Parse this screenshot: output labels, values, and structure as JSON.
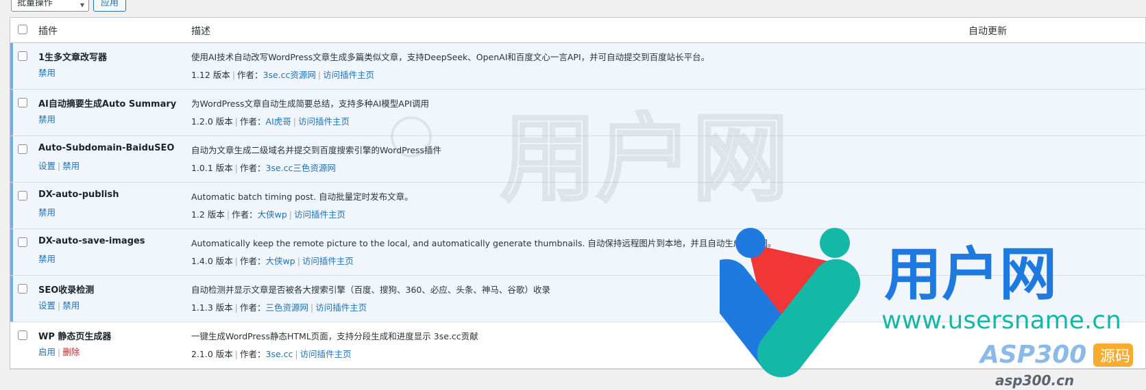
{
  "bulk": {
    "select_value": "批量操作",
    "apply_label": "应用"
  },
  "table": {
    "headers": {
      "plugin": "插件",
      "description": "描述",
      "auto_update": "自动更新"
    },
    "rows": [
      {
        "name": "1生多文章改写器",
        "state": "active",
        "actions": [
          "禁用"
        ],
        "description": "使用AI技术自动改写WordPress文章生成多篇类似文章，支持DeepSeek、OpenAI和百度文心一言API，并可自动提交到百度站长平台。",
        "version": "1.12 版本",
        "author_label": "作者：",
        "author": "3se.cc资源网",
        "homepage": "访问插件主页"
      },
      {
        "name": "AI自动摘要生成Auto Summary",
        "state": "active",
        "actions": [
          "禁用"
        ],
        "description": "为WordPress文章自动生成简要总结，支持多种AI模型API调用",
        "version": "1.2.0 版本",
        "author_label": "作者：",
        "author": "AI虎哥",
        "homepage": "访问插件主页"
      },
      {
        "name": "Auto-Subdomain-BaiduSEO",
        "state": "active",
        "actions": [
          "设置",
          "禁用"
        ],
        "description": "自动为文章生成二级域名并提交到百度搜索引擎的WordPress插件",
        "version": "1.0.1 版本",
        "author_label": "作者：",
        "author": "3se.cc三色资源网",
        "homepage": ""
      },
      {
        "name": "DX-auto-publish",
        "state": "active",
        "actions": [
          "禁用"
        ],
        "description": "Automatic batch timing post. 自动批量定时发布文章。",
        "version": "1.2 版本",
        "author_label": "作者：",
        "author": "大侠wp",
        "homepage": "访问插件主页"
      },
      {
        "name": "DX-auto-save-images",
        "state": "active",
        "actions": [
          "禁用"
        ],
        "description": "Automatically keep the remote picture to the local, and automatically generate thumbnails. 自动保持远程图片到本地，并且自动生成缩略图。",
        "version": "1.4.0 版本",
        "author_label": "作者：",
        "author": "大侠wp",
        "homepage": "访问插件主页"
      },
      {
        "name": "SEO收录检测",
        "state": "active",
        "actions": [
          "设置",
          "禁用"
        ],
        "description": "自动检测并显示文章是否被各大搜索引擎（百度、搜狗、360、必应、头条、神马、谷歌）收录",
        "version": "1.1.3 版本",
        "author_label": "作者：",
        "author": "三色资源网",
        "homepage": "访问插件主页"
      },
      {
        "name": "WP 静态页生成器",
        "state": "inactive",
        "actions": [
          "启用",
          "删除"
        ],
        "description": "一键生成WordPress静态HTML页面，支持分段生成和进度显示 3se.cc贡献",
        "version": "2.1.0 版本",
        "author_label": "作者：",
        "author": "3se.cc",
        "homepage": "访问插件主页"
      }
    ]
  },
  "watermark": {
    "cn": "用户网",
    "url": "www.usersname.cn",
    "brand": "ASP300",
    "brand_tag": "源码",
    "brand_domain": "asp300.cn",
    "colors": {
      "blue": "#1f7ae0",
      "teal": "#14b8a6",
      "red": "#ef2b2b",
      "orange": "#f59e0b"
    }
  },
  "colors": {
    "link": "#2271b1",
    "active_row_bg": "#f0f6fc",
    "active_bar": "#72aee6",
    "delete": "#b32d2e"
  }
}
